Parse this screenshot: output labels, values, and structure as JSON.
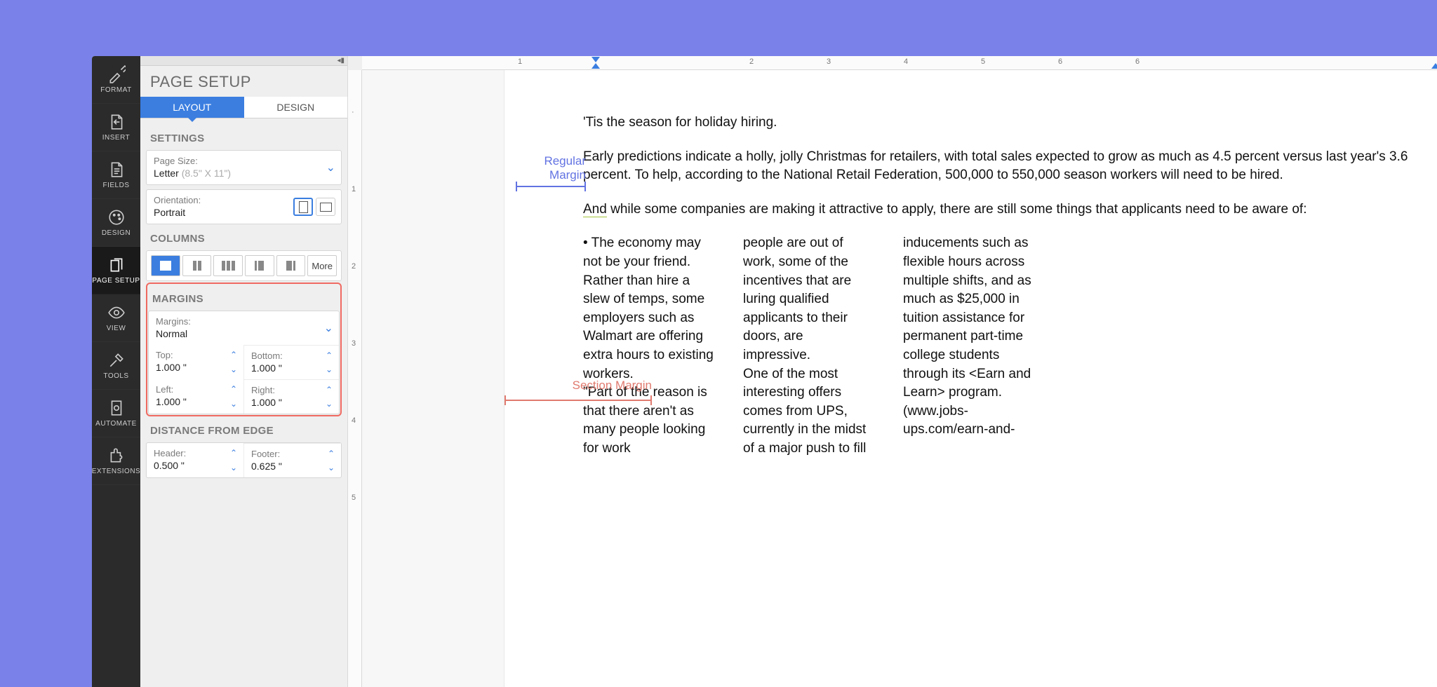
{
  "rail": [
    {
      "id": "format",
      "label": "FORMAT",
      "icon": "brush"
    },
    {
      "id": "insert",
      "label": "INSERT",
      "icon": "page-insert"
    },
    {
      "id": "fields",
      "label": "FIELDS",
      "icon": "page-lines"
    },
    {
      "id": "design",
      "label": "DESIGN",
      "icon": "palette"
    },
    {
      "id": "page-setup",
      "label": "PAGE SETUP",
      "icon": "pages",
      "active": true
    },
    {
      "id": "view",
      "label": "VIEW",
      "icon": "eye"
    },
    {
      "id": "tools",
      "label": "TOOLS",
      "icon": "tools"
    },
    {
      "id": "automate",
      "label": "AUTOMATE",
      "icon": "gear-doc"
    },
    {
      "id": "extensions",
      "label": "EXTENSIONS",
      "icon": "puzzle"
    }
  ],
  "panel": {
    "title": "PAGE SETUP",
    "tabs": {
      "layout": "LAYOUT",
      "design": "DESIGN"
    },
    "settings": {
      "header": "SETTINGS",
      "page_size_label": "Page Size:",
      "page_size_value": "Letter",
      "page_size_dim": "(8.5\" X 11\")",
      "orientation_label": "Orientation:",
      "orientation_value": "Portrait"
    },
    "columns": {
      "header": "COLUMNS",
      "more": "More"
    },
    "margins": {
      "header": "MARGINS",
      "preset_label": "Margins:",
      "preset_value": "Normal",
      "top_label": "Top:",
      "top_value": "1.000 \"",
      "bottom_label": "Bottom:",
      "bottom_value": "1.000 \"",
      "left_label": "Left:",
      "left_value": "1.000 \"",
      "right_label": "Right:",
      "right_value": "1.000 \""
    },
    "distance": {
      "header": "DISTANCE FROM EDGE",
      "header_label": "Header:",
      "header_value": "0.500 \"",
      "footer_label": "Footer:",
      "footer_value": "0.625 \""
    }
  },
  "ruler": {
    "marks": [
      "1",
      "2",
      "3",
      "4",
      "5",
      "6"
    ]
  },
  "callouts": {
    "regular": "Regular Margin",
    "section": "Section Margin"
  },
  "doc": {
    "p1": "'Tis the season for holiday hiring.",
    "p2": "Early predictions indicate a holly, jolly Christmas for retailers, with total sales expected to grow as much as 4.5 percent versus last year's 3.6 percent. To help, according to the National Retail Federation, 500,000 to 550,000 season workers will need to be hired.",
    "p3a": "And",
    "p3b": " while some companies are making it attractive to apply, there are still some things that applicants need to be aware of:",
    "col1": "• The economy may not be your friend. Rather than hire a slew of temps, some employers such as Walmart are offering extra hours to existing workers.\n\"Part of the reason is that there aren't as many people looking for work",
    "col2": "people are out of work, some of the incentives that are luring qualified applicants to their doors, are impressive.\nOne of the most interesting offers comes from UPS, currently in the midst of a major push to fill",
    "col3": "inducements such as flexible hours across multiple shifts, and as much as $25,000 in tuition assistance for permanent part-time college students through its <Earn and Learn> program. (www.jobs-ups.com/earn-and-"
  }
}
